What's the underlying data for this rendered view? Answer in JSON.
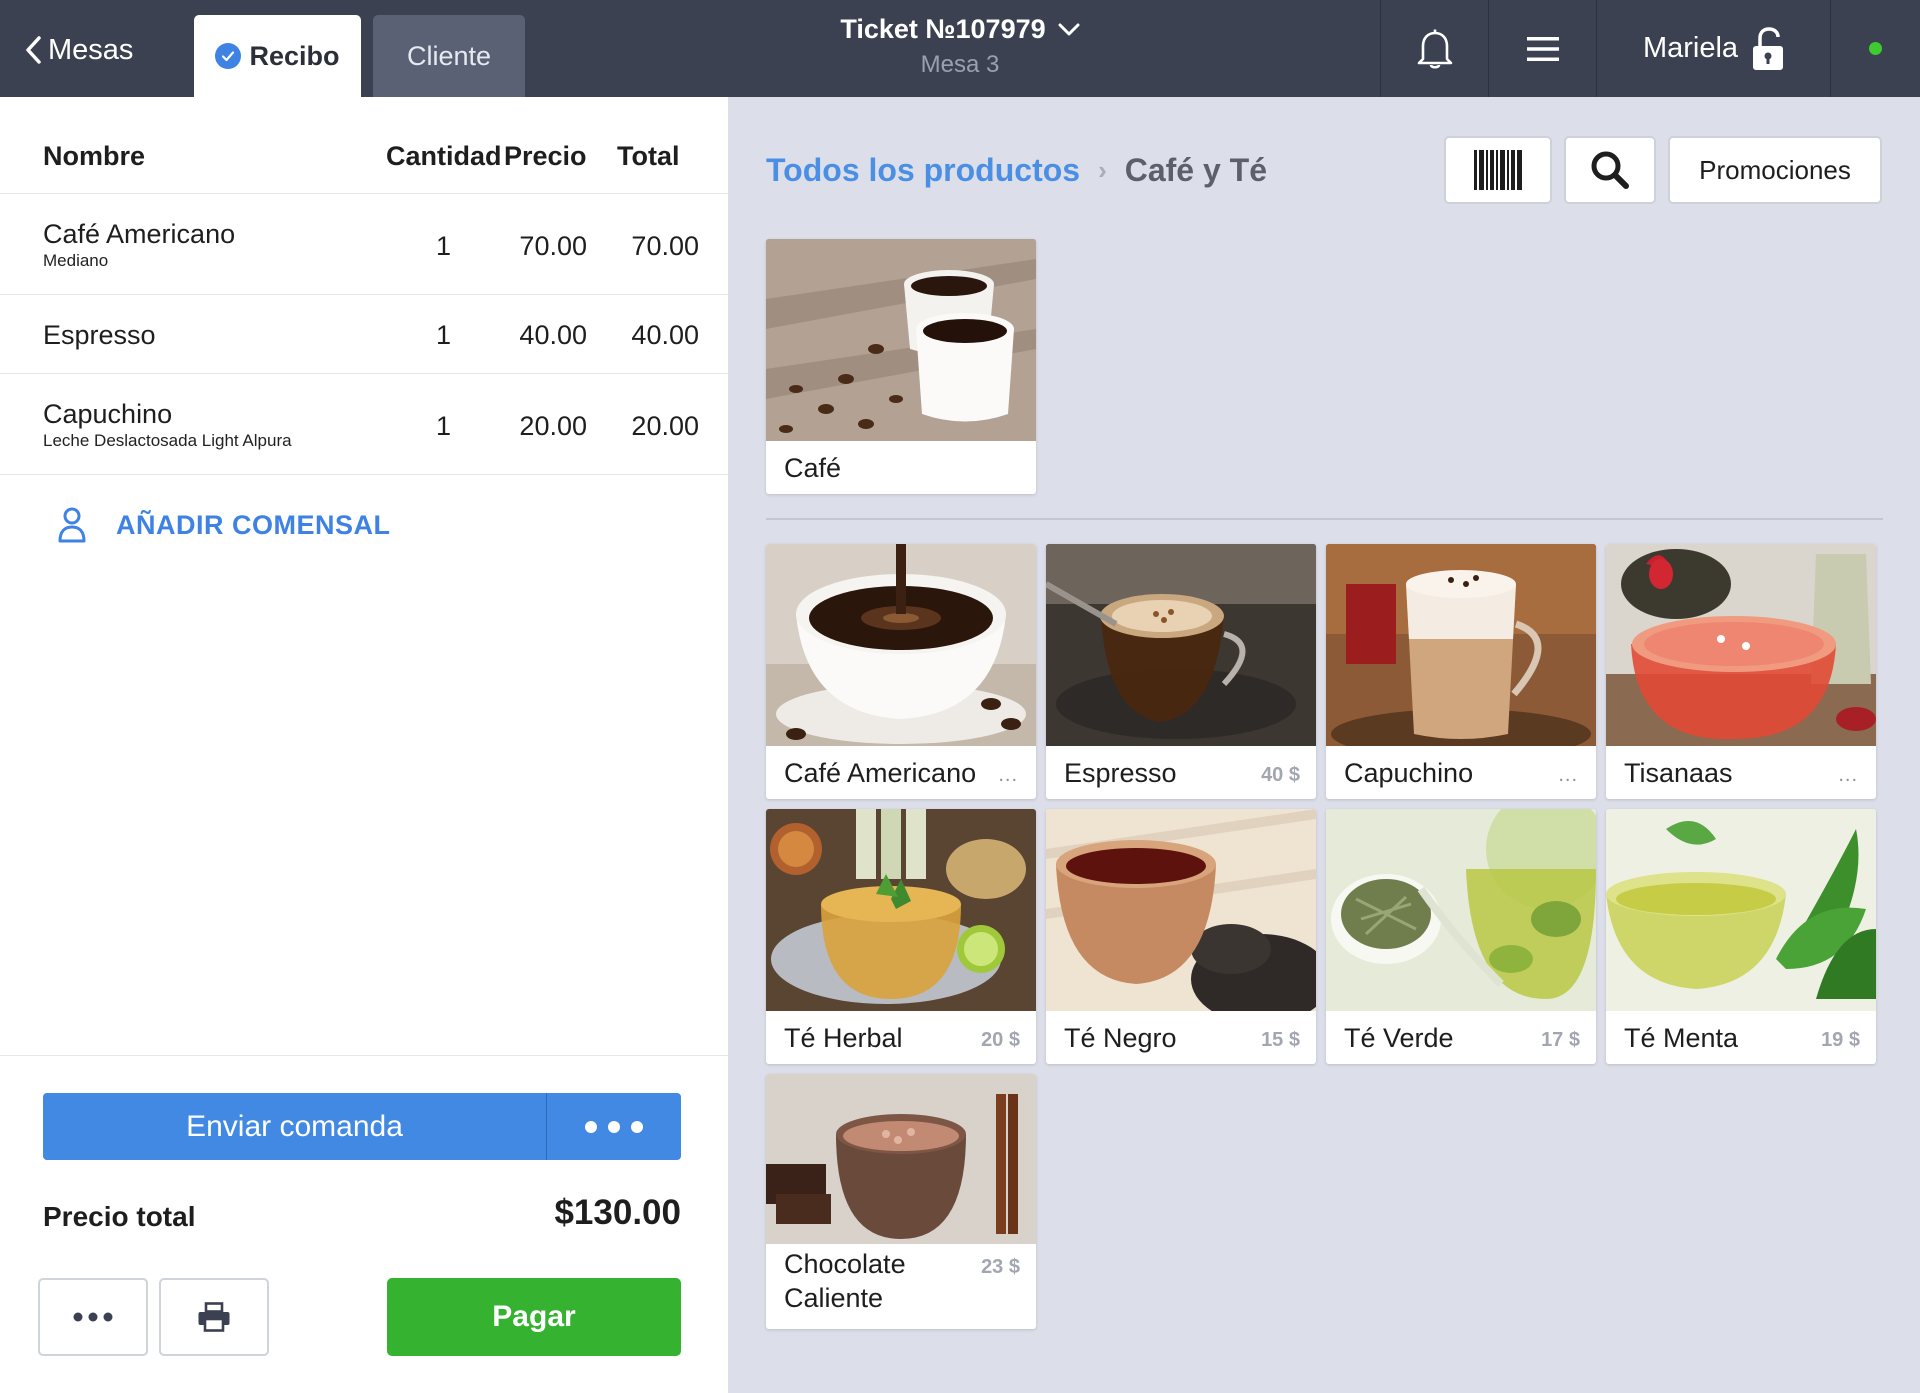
{
  "topbar": {
    "back_label": "Mesas",
    "tabs": [
      {
        "label": "Recibo",
        "active": true
      },
      {
        "label": "Cliente",
        "active": false
      }
    ],
    "ticket_title": "Ticket №107979",
    "ticket_subtitle": "Mesa 3",
    "user_name": "Mariela",
    "status_color": "#3ecb2f"
  },
  "receipt": {
    "headers": {
      "name": "Nombre",
      "qty": "Cantidad",
      "price": "Precio",
      "total": "Total"
    },
    "rows": [
      {
        "name": "Café Americano",
        "modifier": "Mediano",
        "qty": "1",
        "price": "70.00",
        "total": "70.00"
      },
      {
        "name": "Espresso",
        "modifier": "",
        "qty": "1",
        "price": "40.00",
        "total": "40.00"
      },
      {
        "name": "Capuchino",
        "modifier": "Leche Deslactosada Light Alpura",
        "qty": "1",
        "price": "20.00",
        "total": "20.00"
      }
    ],
    "add_guest_label": "AÑADIR COMENSAL",
    "send_label": "Enviar comanda",
    "total_label": "Precio total",
    "total_value": "$130.00",
    "pay_label": "Pagar"
  },
  "catalog": {
    "breadcrumb_root": "Todos los productos",
    "breadcrumb_separator": "›",
    "breadcrumb_current": "Café y Té",
    "promotions_label": "Promociones",
    "category": {
      "name": "Café"
    },
    "products": [
      {
        "name": "Café Americano",
        "price": "...",
        "image": "coffee-cup-pour"
      },
      {
        "name": "Espresso",
        "price": "40 $",
        "image": "espresso-glass"
      },
      {
        "name": "Capuchino",
        "price": "...",
        "image": "cappuccino-glass"
      },
      {
        "name": "Tisanaas",
        "price": "...",
        "image": "fruit-tea"
      },
      {
        "name": "Té Herbal",
        "price": "20 $",
        "image": "herbal-tea"
      },
      {
        "name": "Té Negro",
        "price": "15 $",
        "image": "black-tea"
      },
      {
        "name": "Té Verde",
        "price": "17 $",
        "image": "green-tea"
      },
      {
        "name": "Té Menta",
        "price": "19 $",
        "image": "mint-tea"
      },
      {
        "name": "Chocolate Caliente",
        "price": "23 $",
        "image": "hot-chocolate"
      }
    ]
  },
  "colors": {
    "topbar": "#3b4150",
    "accent_blue": "#4289e4",
    "pay_green": "#35b22f",
    "right_bg": "#dcdfe9"
  }
}
